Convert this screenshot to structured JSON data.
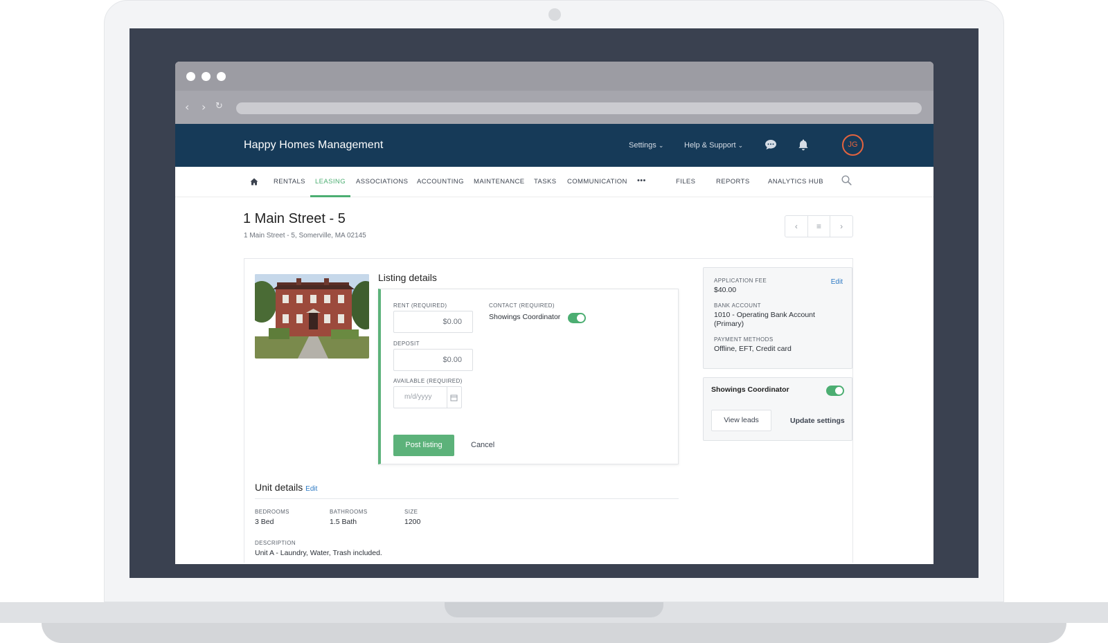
{
  "app": {
    "brand": "Happy Homes Management",
    "settings_label": "Settings",
    "help_label": "Help & Support",
    "avatar_initials": "JG",
    "accent": "#4cae72",
    "header_bg": "#163a58"
  },
  "nav": {
    "items": [
      "RENTALS",
      "LEASING",
      "ASSOCIATIONS",
      "ACCOUNTING",
      "MAINTENANCE",
      "TASKS",
      "COMMUNICATION",
      "•••",
      "FILES",
      "REPORTS",
      "ANALYTICS HUB"
    ],
    "active": "LEASING"
  },
  "page": {
    "title": "1 Main Street - 5",
    "subtitle": "1 Main Street - 5, Somerville, MA 02145"
  },
  "listing": {
    "title": "Listing details",
    "rent_label": "RENT (REQUIRED)",
    "rent_value": "$0.00",
    "deposit_label": "DEPOSIT",
    "deposit_value": "$0.00",
    "available_label": "AVAILABLE (REQUIRED)",
    "available_placeholder": "m/d/yyyy",
    "contact_label": "CONTACT (REQUIRED)",
    "contact_value": "Showings Coordinator",
    "post_button": "Post listing",
    "cancel_button": "Cancel"
  },
  "unit": {
    "title": "Unit details",
    "edit_label": "Edit",
    "bedrooms_label": "BEDROOMS",
    "bedrooms_value": "3 Bed",
    "bathrooms_label": "BATHROOMS",
    "bathrooms_value": "1.5 Bath",
    "size_label": "SIZE",
    "size_value": "1200",
    "description_label": "DESCRIPTION",
    "description_value": "Unit A - Laundry, Water, Trash included."
  },
  "fees": {
    "application_fee_label": "APPLICATION FEE",
    "application_fee_value": "$40.00",
    "edit_label": "Edit",
    "bank_account_label": "BANK ACCOUNT",
    "bank_account_value": "1010 - Operating Bank Account (Primary)",
    "payment_methods_label": "PAYMENT METHODS",
    "payment_methods_value": "Offline, EFT, Credit card"
  },
  "showings": {
    "title": "Showings Coordinator",
    "view_leads": "View leads",
    "update_settings": "Update settings"
  }
}
